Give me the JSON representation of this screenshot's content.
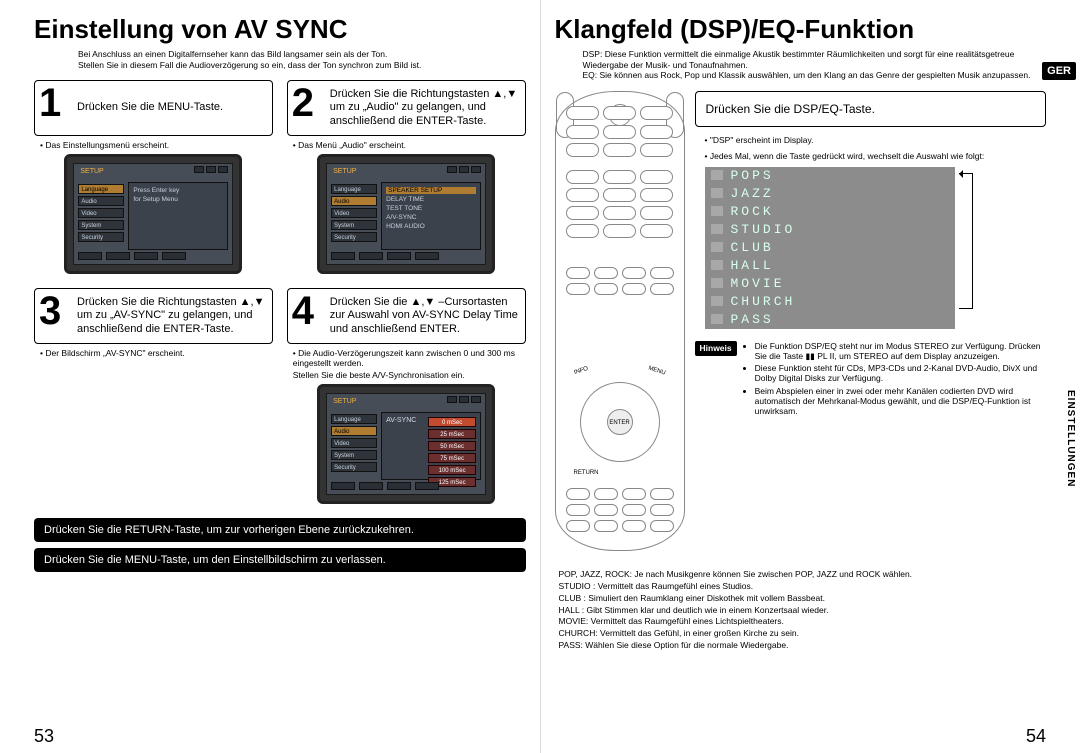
{
  "lang_badge": "GER",
  "section_label": "EINSTELLUNGEN",
  "left": {
    "title": "Einstellung von AV SYNC",
    "intro": "Bei Anschluss an einen Digitalfernseher kann das Bild langsamer sein als der Ton.\nStellen Sie in diesem Fall die Audioverzögerung so ein, dass der Ton synchron zum Bild ist.",
    "steps": {
      "s1": {
        "num": "1",
        "text": "Drücken Sie die MENU-Taste.",
        "note": "• Das Einstellungsmenü erscheint."
      },
      "s2": {
        "num": "2",
        "text": "Drücken Sie die Richtungstasten ▲,▼ um zu „Audio\" zu gelangen, und anschließend die ENTER-Taste.",
        "note": "• Das Menü „Audio\" erscheint."
      },
      "s3": {
        "num": "3",
        "text": "Drücken Sie die Richtungstasten ▲,▼ um zu „AV-SYNC\" zu gelangen, und anschließend die ENTER-Taste.",
        "note": "• Der Bildschirm „AV-SYNC\" erscheint."
      },
      "s4": {
        "num": "4",
        "text": "Drücken Sie die ▲,▼ –Cursortasten zur Auswahl von AV-SYNC Delay Time und anschließend ENTER.",
        "note1": "• Die Audio-Verzögerungszeit kann zwischen 0 und 300 ms eingestellt werden.",
        "note2": "Stellen Sie die beste A/V-Synchronisation ein."
      }
    },
    "tv_menu": {
      "title": "SETUP",
      "left_items": [
        "Language",
        "Audio",
        "Video",
        "System",
        "Security"
      ],
      "main_hint1": "Press Enter key",
      "main_hint2": "for Setup Menu",
      "audio_items": [
        "SPEAKER SETUP",
        "DELAY TIME",
        "TEST TONE",
        "A/V-SYNC",
        "HDMI AUDIO"
      ],
      "avsync_title": "AV-SYNC",
      "av_values": [
        "0 mSec",
        "25 mSec",
        "50 mSec",
        "75 mSec",
        "100 mSec",
        "125 mSec"
      ]
    },
    "bar_return": "Drücken Sie die RETURN-Taste, um zur vorherigen Ebene zurückzukehren.",
    "bar_menu": "Drücken Sie die MENU-Taste, um den Einstellbildschirm zu verlassen.",
    "page_num": "53"
  },
  "right": {
    "title": "Klangfeld (DSP)/EQ-Funktion",
    "intro": "DSP: Diese Funktion vermittelt die einmalige Akustik bestimmter Räumlichkeiten und sorgt für eine realitätsgetreue Wiedergabe der Musik- und Tonaufnahmen.\nEQ: Sie können aus Rock, Pop und Klassik auswählen, um den Klang an das Genre der gespielten Musik anzupassen.",
    "instruction": "Drücken Sie die DSP/EQ-Taste.",
    "notes": {
      "n1": "• \"DSP\" erscheint im Display.",
      "n2": "• Jedes Mal, wenn die Taste gedrückt wird, wechselt die Auswahl wie folgt:"
    },
    "modes": [
      "POPS",
      "JAZZ",
      "ROCK",
      "STUDIO",
      "CLUB",
      "HALL",
      "MOVIE",
      "CHURCH",
      "PASS"
    ],
    "hinweis_label": "Hinweis",
    "hinweis": {
      "h1": "Die Funktion DSP/EQ steht nur im Modus STEREO zur Verfügung. Drücken Sie die Taste ▮▮ PL II, um STEREO auf dem Display anzuzeigen.",
      "h2": "Diese Funktion steht für CDs, MP3-CDs und 2-Kanal DVD-Audio, DivX und Dolby Digital Disks zur Verfügung.",
      "h3": "Beim Abspielen einer in zwei oder mehr Kanälen codierten DVD wird automatisch der Mehrkanal-Modus gewählt, und die DSP/EQ-Funktion ist unwirksam."
    },
    "glossary": {
      "g1": "POP, JAZZ, ROCK: Je nach Musikgenre können Sie zwischen POP, JAZZ und ROCK wählen.",
      "g2": "STUDIO : Vermittelt das Raumgefühl eines Studios.",
      "g3": "CLUB : Simuliert den Raumklang einer Diskothek mit vollem Bassbeat.",
      "g4": "HALL : Gibt Stimmen klar und deutlich wie in einem Konzertsaal wieder.",
      "g5": "MOVIE: Vermittelt das Raumgefühl eines Lichtspieltheaters.",
      "g6": "CHURCH: Vermittelt das Gefühl, in einer großen Kirche zu sein.",
      "g7": "PASS: Wählen Sie diese Option für die normale Wiedergabe."
    },
    "remote_labels": {
      "enter": "ENTER",
      "menu": "MENU",
      "info": "INFO",
      "return": "RETURN"
    },
    "page_num": "54"
  }
}
